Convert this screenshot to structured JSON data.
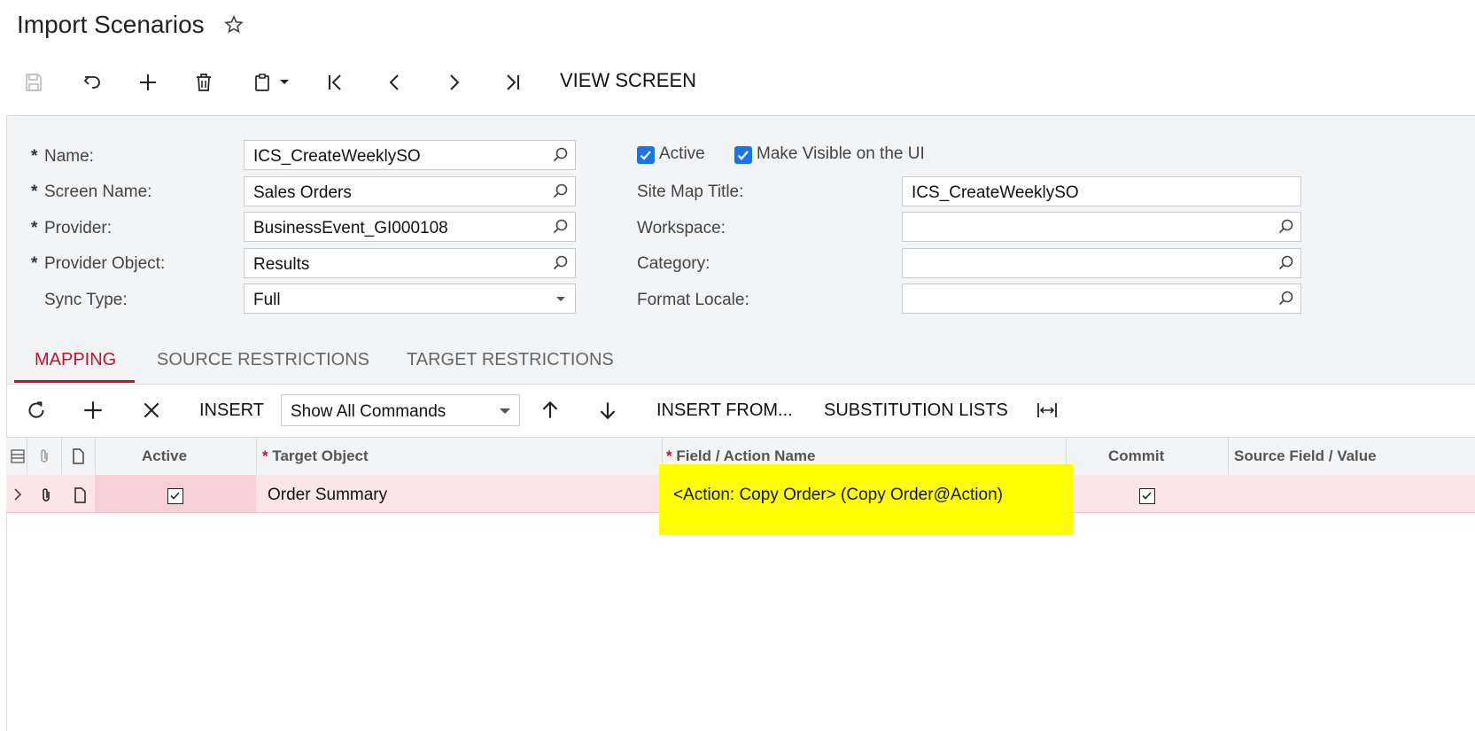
{
  "page": {
    "title": "Import Scenarios"
  },
  "toolbar": {
    "view_screen": "VIEW SCREEN"
  },
  "form": {
    "name_label": "Name:",
    "name_value": "ICS_CreateWeeklySO",
    "screen_name_label": "Screen Name:",
    "screen_name_value": "Sales Orders",
    "provider_label": "Provider:",
    "provider_value": "BusinessEvent_GI000108",
    "provider_object_label": "Provider Object:",
    "provider_object_value": "Results",
    "sync_type_label": "Sync Type:",
    "sync_type_value": "Full",
    "required_mark": "*",
    "active_label": "Active",
    "make_visible_label": "Make Visible on the UI",
    "site_map_title_label": "Site Map Title:",
    "site_map_title_value": "ICS_CreateWeeklySO",
    "workspace_label": "Workspace:",
    "workspace_value": "",
    "category_label": "Category:",
    "category_value": "",
    "format_locale_label": "Format Locale:",
    "format_locale_value": ""
  },
  "tabs": [
    {
      "label": "MAPPING",
      "active": true
    },
    {
      "label": "SOURCE RESTRICTIONS",
      "active": false
    },
    {
      "label": "TARGET RESTRICTIONS",
      "active": false
    }
  ],
  "grid_toolbar": {
    "insert": "INSERT",
    "commands_select": "Show All Commands",
    "insert_from": "INSERT FROM...",
    "substitution_lists": "SUBSTITUTION LISTS"
  },
  "grid": {
    "columns": {
      "active": "Active",
      "target_object": "Target Object",
      "field_action_name": "Field / Action Name",
      "commit": "Commit",
      "source_field_value": "Source Field / Value",
      "required_mark": "*"
    },
    "rows": [
      {
        "active": true,
        "target_object": "Order Summary",
        "field_action_name": "<Action: Copy Order> (Copy Order@Action)",
        "commit": true,
        "source_field_value": ""
      }
    ]
  },
  "colors": {
    "accent": "#c8102e",
    "checkbox": "#1a73e8",
    "highlight": "#ffff00",
    "row_selected": "#fbe5e8"
  }
}
